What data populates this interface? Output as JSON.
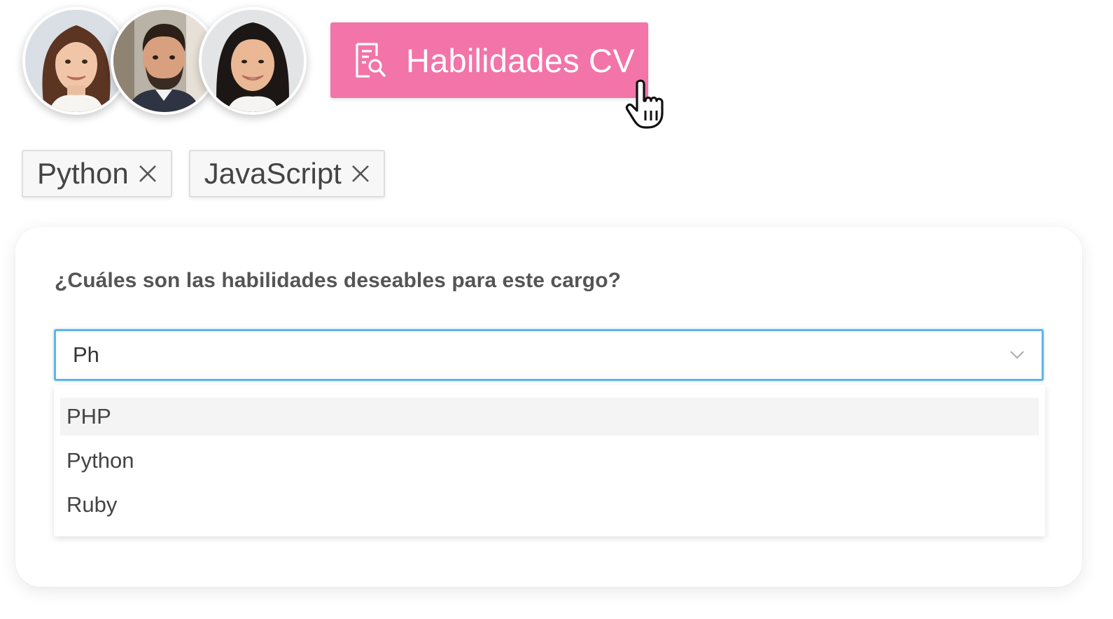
{
  "avatars": [
    {
      "name": "avatar-woman-brown-hair"
    },
    {
      "name": "avatar-man-beard"
    },
    {
      "name": "avatar-woman-black-hair"
    }
  ],
  "cv_button": {
    "label": "Habilidades CV",
    "icon": "document-search-icon",
    "color": "#f274a8"
  },
  "tags": [
    {
      "label": "Python",
      "remove_icon": "close-icon"
    },
    {
      "label": "JavaScript",
      "remove_icon": "close-icon"
    }
  ],
  "card": {
    "question": "¿Cuáles son las habilidades deseables para este cargo?",
    "input": {
      "value": "Ph",
      "focus_color": "#62b3ea",
      "chevron_icon": "chevron-down-icon"
    },
    "options": [
      {
        "label": "PHP",
        "highlighted": true
      },
      {
        "label": "Python",
        "highlighted": false
      },
      {
        "label": "Ruby",
        "highlighted": false
      }
    ]
  }
}
